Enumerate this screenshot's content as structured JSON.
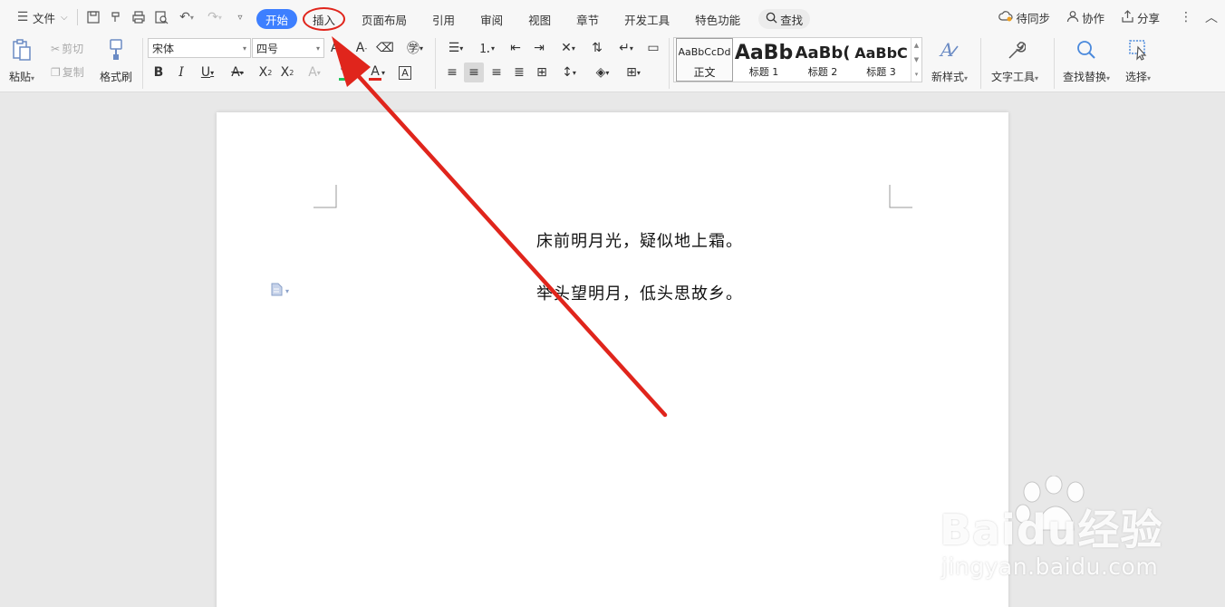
{
  "menubar": {
    "file_label": "文件",
    "tabs": [
      "开始",
      "插入",
      "页面布局",
      "引用",
      "审阅",
      "视图",
      "章节",
      "开发工具",
      "特色功能"
    ],
    "search_label": "查找",
    "sync_label": "待同步",
    "collab_label": "协作",
    "share_label": "分享"
  },
  "ribbon": {
    "paste_label": "粘贴",
    "cut_label": "剪切",
    "copy_label": "复制",
    "format_painter_label": "格式刷",
    "font_name": "宋体",
    "font_size": "四号",
    "styles": [
      {
        "preview": "AaBbCcDd",
        "name": "正文"
      },
      {
        "preview": "AaBb",
        "name": "标题 1"
      },
      {
        "preview": "AaBb(",
        "name": "标题 2"
      },
      {
        "preview": "AaBbC",
        "name": "标题 3"
      }
    ],
    "new_style_label": "新样式",
    "text_tools_label": "文字工具",
    "find_replace_label": "查找替换",
    "select_label": "选择"
  },
  "document": {
    "lines": [
      "床前明月光，疑似地上霜。",
      "举头望明月，低头思故乡。"
    ]
  },
  "colors": {
    "accent": "#3d7fff",
    "annotation": "#e0251c",
    "highlight_bar": "#22c55e",
    "font_color_bar": "#e0251c"
  },
  "watermark": {
    "brand": "Baidu经验",
    "url": "jingyan.baidu.com"
  }
}
